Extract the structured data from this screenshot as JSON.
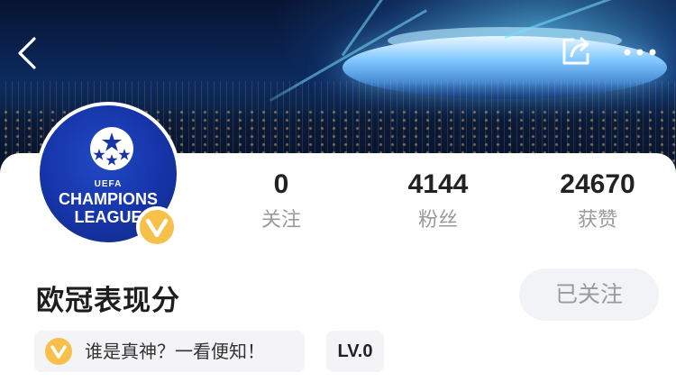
{
  "profile": {
    "name": "欧冠表现分",
    "avatar": {
      "uefa": "UEFA",
      "line1": "CHAMPIONS",
      "line2": "LEAGUE"
    },
    "verified_color": "#f6c04a",
    "stats": [
      {
        "value": "0",
        "label": "关注"
      },
      {
        "value": "4144",
        "label": "粉丝"
      },
      {
        "value": "24670",
        "label": "获赞"
      }
    ],
    "follow_button": "已关注",
    "motto": "谁是真神？一看便知！",
    "level": "LV.0"
  },
  "topbar": {
    "back_icon": "chevron-left-icon",
    "share_icon": "share-icon",
    "more_icon": "more-dots-icon"
  },
  "colors": {
    "banner": "#0c2a5f",
    "avatar_blue": "#1634a8",
    "badge_gold": "#f6c04a",
    "button_bg": "#f2f3f6",
    "muted_text": "#9a9a9a"
  }
}
